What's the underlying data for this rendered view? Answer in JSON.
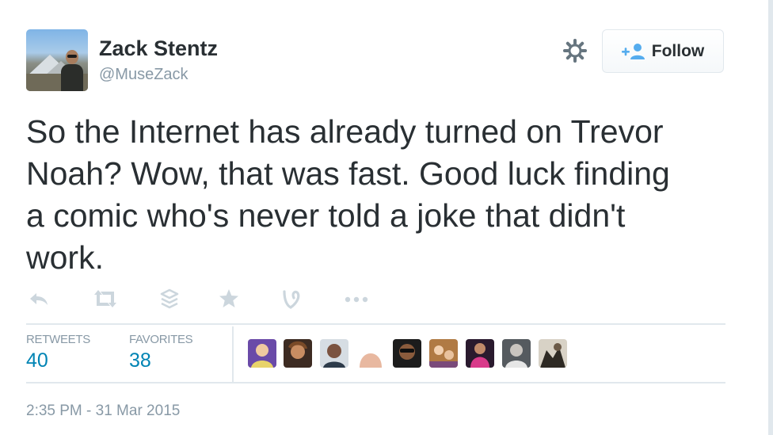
{
  "author": {
    "display_name": "Zack Stentz",
    "screen_name": "@MuseZack"
  },
  "header": {
    "follow_label": "Follow"
  },
  "tweet": {
    "text": "So the Internet has already turned on Trevor\nNoah? Wow, that was fast. Good luck finding\na comic who's never told a joke that didn't\nwork."
  },
  "actions": [
    "reply-icon",
    "retweet-icon",
    "buffer-icon",
    "favorite-icon",
    "vine-icon",
    "more-icon"
  ],
  "stats": {
    "retweets_label": "RETWEETS",
    "retweets_value": "40",
    "favorites_label": "FAVORITES",
    "favorites_value": "38"
  },
  "favoriters_count": 10,
  "timestamp": "2:35 PM - 31 Mar 2015",
  "colors": {
    "link_blue": "#0084b4",
    "muted_gray": "#8899a6",
    "text_dark": "#292f33",
    "border": "#e1e8ed"
  }
}
